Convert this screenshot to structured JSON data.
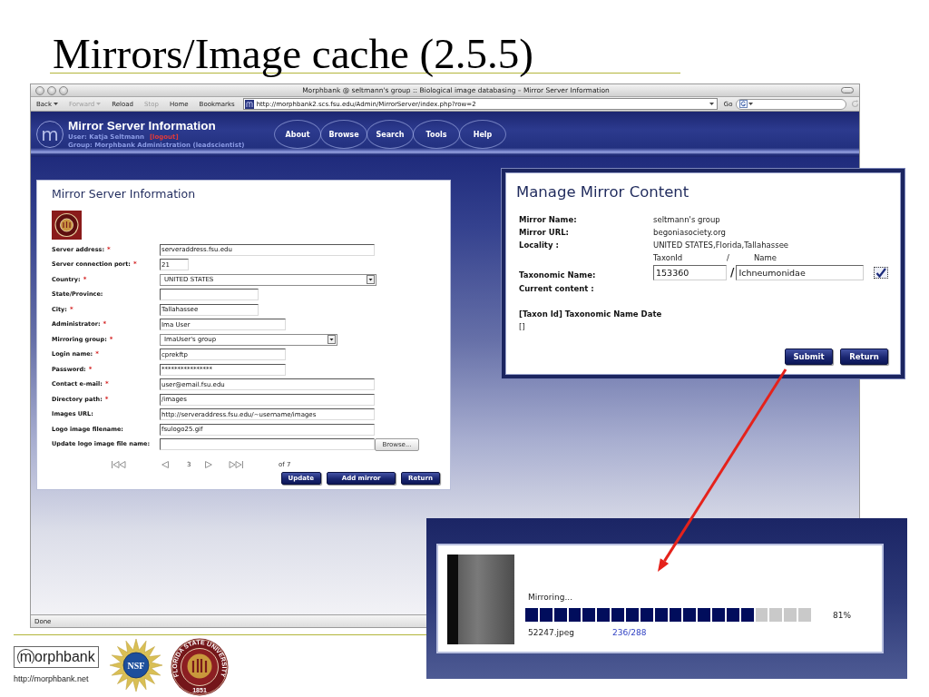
{
  "slide": {
    "title": "Mirrors/Image cache (2.5.5)"
  },
  "browser": {
    "window_title": "Morphbank @ seltmann's group :: Biological image databasing – Mirror Server Information",
    "toolbar": [
      {
        "label": "Back",
        "disabled": false,
        "menu": true
      },
      {
        "label": "Forward",
        "disabled": true,
        "menu": true
      },
      {
        "label": "Reload",
        "disabled": false,
        "menu": false
      },
      {
        "label": "Stop",
        "disabled": true,
        "menu": false
      },
      {
        "label": "Home",
        "disabled": false,
        "menu": false
      },
      {
        "label": "Bookmarks",
        "disabled": false,
        "menu": false
      }
    ],
    "address": "http://morphbank2.scs.fsu.edu/Admin/MirrorServer/index.php?row=2",
    "go": "Go",
    "status": "Done"
  },
  "site_header": {
    "logo_mark": "m",
    "title": "Mirror Server Information",
    "user": "User: Katja Seltmann",
    "logout": "[logout]",
    "group": "Group: Morphbank Administration (leadscientist)",
    "nav": [
      "About",
      "Browse",
      "Search",
      "Tools",
      "Help"
    ]
  },
  "server_form": {
    "title": "Mirror Server Information",
    "fields": [
      {
        "label": "Server address:",
        "required_mark": "*",
        "kind": "text",
        "value": "serveraddress.fsu.edu"
      },
      {
        "label": "Server connection port:",
        "required_mark": "*",
        "kind": "text",
        "value": "21"
      },
      {
        "label": "Country:",
        "required_mark": "*",
        "kind": "select",
        "value": "UNITED STATES"
      },
      {
        "label": "State/Province:",
        "kind": "text"
      },
      {
        "label": "City:",
        "required_mark": "*",
        "kind": "text",
        "value": "Tallahassee"
      },
      {
        "label": "Administrator:",
        "required_mark": "*",
        "kind": "text",
        "value": "Ima User"
      },
      {
        "label": "Mirroring group:",
        "required_mark": "*",
        "kind": "select",
        "value": "ImaUser's group"
      },
      {
        "label": "Login name:",
        "required_mark": "*",
        "kind": "text",
        "value": "cprekftp"
      },
      {
        "label": "Password:",
        "required_mark": "*",
        "kind": "text",
        "value": "****************"
      },
      {
        "label": "Contact e-mail:",
        "required_mark": "*",
        "kind": "text",
        "value": "user@email.fsu.edu"
      },
      {
        "label": "Directory path:",
        "required_mark": "*",
        "kind": "text",
        "value": "/images"
      },
      {
        "label": "Images URL:",
        "kind": "text",
        "value": "http://serveraddress.fsu.edu/~username/images"
      },
      {
        "label": "Logo image filename:",
        "kind": "text",
        "value": "fsulogo25.gif"
      },
      {
        "label": "Update logo image file name:",
        "kind": "file",
        "button": "Browse..."
      }
    ],
    "pager": {
      "page": "3",
      "total": "of 7"
    },
    "buttons": [
      "Update",
      "Add mirror",
      "Return"
    ]
  },
  "manage_dialog": {
    "title": "Manage Mirror Content",
    "info": [
      {
        "label": "Mirror Name:",
        "value": "seltmann's group"
      },
      {
        "label": "Mirror URL:",
        "value": "begoniasociety.org"
      },
      {
        "label": "Locality :",
        "value": "UNITED STATES,Florida,Tallahassee"
      }
    ],
    "taxon_headers": [
      "TaxonId",
      "/",
      "Name"
    ],
    "taxon": {
      "label": "Taxonomic Name:",
      "taxon_id": "153360",
      "separator": "/",
      "name": "Ichneumonidae",
      "checked": true
    },
    "current_content_label": "Current content :",
    "list_header": "[Taxon Id] Taxonomic Name Date",
    "list_value": "[]",
    "buttons": [
      "Submit",
      "Return"
    ]
  },
  "mirror_progress": {
    "status": "Mirroring...",
    "level": 0.81,
    "percent": "81%",
    "file": "52247.jpeg",
    "count": "236/288"
  },
  "footer": {
    "logo_mark": "m",
    "wordmark": "orphbank",
    "url": "http://morphbank.net",
    "nsf": "NSF",
    "seal_text": "FLORIDA STATE UNIVERSITY",
    "seal_year": "1851"
  }
}
